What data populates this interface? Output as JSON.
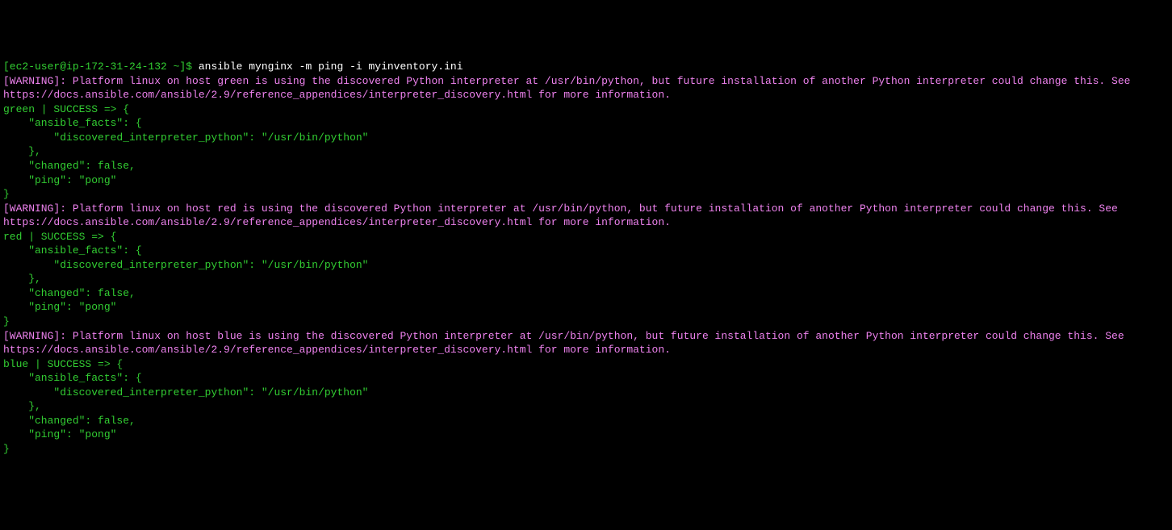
{
  "prompt": {
    "user_host": "[ec2-user@ip-172-31-24-132 ~]$ ",
    "command": "ansible mynginx -m ping -i myinventory.ini"
  },
  "hosts": [
    {
      "name": "green",
      "warning": "[WARNING]: Platform linux on host green is using the discovered Python interpreter at /usr/bin/python, but future installation of another Python interpreter could change this. See",
      "warning2": "https://docs.ansible.com/ansible/2.9/reference_appendices/interpreter_discovery.html for more information.",
      "result_header": "green | SUCCESS => {",
      "ansible_facts": "    \"ansible_facts\": {",
      "discovered": "        \"discovered_interpreter_python\": \"/usr/bin/python\"",
      "close_facts": "    },",
      "changed": "    \"changed\": false,",
      "ping": "    \"ping\": \"pong\"",
      "close": "}"
    },
    {
      "name": "red",
      "warning": "[WARNING]: Platform linux on host red is using the discovered Python interpreter at /usr/bin/python, but future installation of another Python interpreter could change this. See",
      "warning2": "https://docs.ansible.com/ansible/2.9/reference_appendices/interpreter_discovery.html for more information.",
      "result_header": "red | SUCCESS => {",
      "ansible_facts": "    \"ansible_facts\": {",
      "discovered": "        \"discovered_interpreter_python\": \"/usr/bin/python\"",
      "close_facts": "    },",
      "changed": "    \"changed\": false,",
      "ping": "    \"ping\": \"pong\"",
      "close": "}"
    },
    {
      "name": "blue",
      "warning": "[WARNING]: Platform linux on host blue is using the discovered Python interpreter at /usr/bin/python, but future installation of another Python interpreter could change this. See",
      "warning2": "https://docs.ansible.com/ansible/2.9/reference_appendices/interpreter_discovery.html for more information.",
      "result_header": "blue | SUCCESS => {",
      "ansible_facts": "    \"ansible_facts\": {",
      "discovered": "        \"discovered_interpreter_python\": \"/usr/bin/python\"",
      "close_facts": "    },",
      "changed": "    \"changed\": false,",
      "ping": "    \"ping\": \"pong\"",
      "close": "}"
    }
  ]
}
